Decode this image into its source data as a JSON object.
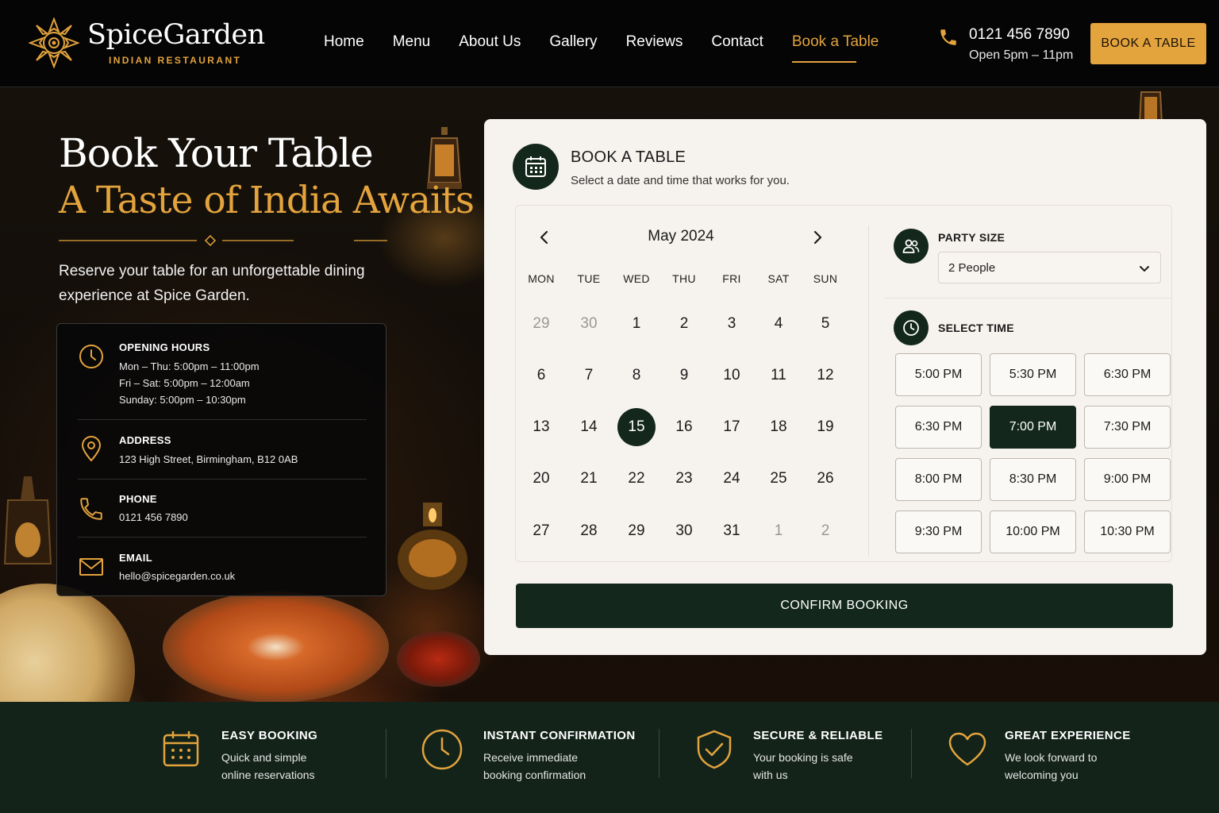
{
  "header": {
    "brand_name": "SpiceGarden",
    "brand_sub": "INDIAN RESTAURANT",
    "nav": [
      {
        "label": "Home"
      },
      {
        "label": "Menu"
      },
      {
        "label": "About Us"
      },
      {
        "label": "Gallery"
      },
      {
        "label": "Reviews"
      },
      {
        "label": "Contact"
      },
      {
        "label": "Book a Table",
        "active": true
      }
    ],
    "phone": "0121 456 7890",
    "hours": "Open 5pm – 11pm",
    "cta_label": "BOOK A TABLE"
  },
  "hero": {
    "title": "Book Your Table",
    "subtitle": "A Taste of India Awaits",
    "description": "Reserve your table for an unforgettable dining experience at Spice Garden."
  },
  "info": {
    "hours_heading": "OPENING HOURS",
    "hours_lines": [
      "Mon – Thu: 5:00pm – 11:00pm",
      "Fri – Sat: 5:00pm – 12:00am",
      "Sunday: 5:00pm – 10:30pm"
    ],
    "address_heading": "ADDRESS",
    "address": "123 High Street, Birmingham, B12 0AB",
    "phone_heading": "PHONE",
    "phone": "0121 456 7890",
    "email_heading": "EMAIL",
    "email": "hello@spicegarden.co.uk"
  },
  "booking": {
    "title": "BOOK A TABLE",
    "subtitle": "Select a date and time that works for you.",
    "calendar": {
      "month": "May 2024",
      "weekdays": [
        "MON",
        "TUE",
        "WED",
        "THU",
        "FRI",
        "SAT",
        "SUN"
      ],
      "weeks": [
        [
          {
            "d": "29",
            "muted": true
          },
          {
            "d": "30",
            "muted": true
          },
          {
            "d": "1"
          },
          {
            "d": "2"
          },
          {
            "d": "3"
          },
          {
            "d": "4"
          },
          {
            "d": "5"
          }
        ],
        [
          {
            "d": "6"
          },
          {
            "d": "7"
          },
          {
            "d": "8"
          },
          {
            "d": "9"
          },
          {
            "d": "10"
          },
          {
            "d": "11"
          },
          {
            "d": "12"
          }
        ],
        [
          {
            "d": "13"
          },
          {
            "d": "14"
          },
          {
            "d": "15",
            "selected": true
          },
          {
            "d": "16"
          },
          {
            "d": "17"
          },
          {
            "d": "18"
          },
          {
            "d": "19"
          }
        ],
        [
          {
            "d": "20"
          },
          {
            "d": "21"
          },
          {
            "d": "22"
          },
          {
            "d": "23"
          },
          {
            "d": "24"
          },
          {
            "d": "25"
          },
          {
            "d": "26"
          }
        ],
        [
          {
            "d": "27"
          },
          {
            "d": "28"
          },
          {
            "d": "29"
          },
          {
            "d": "30"
          },
          {
            "d": "31"
          },
          {
            "d": "1",
            "muted": true
          },
          {
            "d": "2",
            "muted": true
          }
        ]
      ]
    },
    "party_label": "PARTY SIZE",
    "party_value": "2 People",
    "time_label": "SELECT TIME",
    "times": [
      {
        "t": "5:00 PM"
      },
      {
        "t": "5:30 PM"
      },
      {
        "t": "6:30 PM"
      },
      {
        "t": "6:30 PM"
      },
      {
        "t": "7:00 PM",
        "selected": true
      },
      {
        "t": "7:30 PM"
      },
      {
        "t": "8:00 PM"
      },
      {
        "t": "8:30 PM"
      },
      {
        "t": "9:00 PM"
      },
      {
        "t": "9:30 PM"
      },
      {
        "t": "10:00 PM"
      },
      {
        "t": "10:30 PM"
      }
    ],
    "confirm_label": "CONFIRM BOOKING"
  },
  "features": [
    {
      "title": "EASY BOOKING",
      "text": "Quick and simple online reservations",
      "icon": "calendar-icon"
    },
    {
      "title": "INSTANT CONFIRMATION",
      "text": "Receive immediate booking confirmation",
      "icon": "clock-icon"
    },
    {
      "title": "SECURE & RELIABLE",
      "text": "Your booking is safe with us",
      "icon": "shield-check-icon"
    },
    {
      "title": "GREAT EXPERIENCE",
      "text": "We look forward to welcoming you",
      "icon": "heart-icon"
    }
  ],
  "colors": {
    "accent": "#e3a33d",
    "dark_green": "#13271c",
    "panel": "#f6f2ed",
    "feature_bar": "#13231a"
  }
}
